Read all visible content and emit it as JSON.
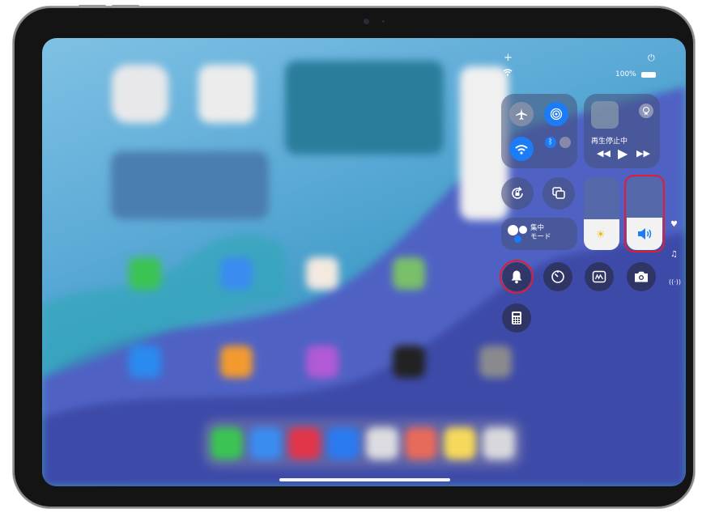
{
  "status_bar": {
    "battery_percent": "100%"
  },
  "now_playing": {
    "status_label": "再生停止中"
  },
  "focus": {
    "label": "集中\nモード"
  },
  "sliders": {
    "brightness_level": 0.42,
    "volume_level": 0.44
  },
  "colors": {
    "accent_blue": "#1c7cf5",
    "highlight_red": "#e21d2d"
  }
}
